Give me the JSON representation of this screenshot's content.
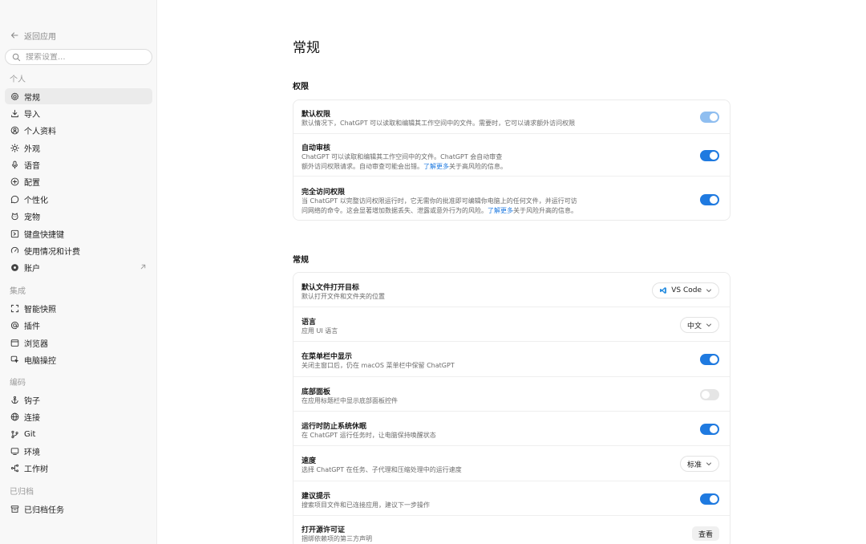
{
  "sidebar": {
    "back_label": "返回应用",
    "search_placeholder": "搜索设置...",
    "groups": [
      {
        "label": "个人",
        "items": [
          {
            "label": "常规",
            "icon": "gear-icon",
            "active": true
          },
          {
            "label": "导入",
            "icon": "download-icon"
          },
          {
            "label": "个人资料",
            "icon": "user-circle-icon"
          },
          {
            "label": "外观",
            "icon": "sun-icon"
          },
          {
            "label": "语音",
            "icon": "microphone-icon"
          },
          {
            "label": "配置",
            "icon": "config-icon"
          },
          {
            "label": "个性化",
            "icon": "chat-bubble-icon"
          },
          {
            "label": "宠物",
            "icon": "pet-icon"
          },
          {
            "label": "键盘快捷键",
            "icon": "keyboard-icon"
          },
          {
            "label": "使用情况和计费",
            "icon": "gauge-icon"
          },
          {
            "label": "账户",
            "icon": "globe-icon",
            "external": true
          }
        ]
      },
      {
        "label": "集成",
        "items": [
          {
            "label": "智能快照",
            "icon": "scan-frame-icon"
          },
          {
            "label": "插件",
            "icon": "at-sign-icon"
          },
          {
            "label": "浏览器",
            "icon": "browser-window-icon"
          },
          {
            "label": "电脑操控",
            "icon": "cursor-click-icon"
          }
        ]
      },
      {
        "label": "编码",
        "items": [
          {
            "label": "钩子",
            "icon": "anchor-icon"
          },
          {
            "label": "连接",
            "icon": "globe-network-icon"
          },
          {
            "label": "Git",
            "icon": "git-branch-icon"
          },
          {
            "label": "环境",
            "icon": "monitor-icon"
          },
          {
            "label": "工作树",
            "icon": "tree-branch-icon"
          }
        ]
      },
      {
        "label": "已归档",
        "items": [
          {
            "label": "已归档任务",
            "icon": "archive-box-icon"
          }
        ]
      }
    ]
  },
  "main": {
    "page_title": "常规",
    "permissions": {
      "title": "权限",
      "rows": [
        {
          "title": "默认权限",
          "desc": "默认情况下，ChatGPT 可以读取和编辑其工作空间中的文件。需要时，它可以请求额外访问权限",
          "toggle": "dim"
        },
        {
          "title": "自动审核",
          "desc1": "ChatGPT 可以读取和编辑其工作空间中的文件。ChatGPT 会自动审查",
          "desc2_pre": "额外访问权限请求。自动审查可能会出错。",
          "link": "了解更多",
          "desc2_post": "关于高风险的信息。",
          "toggle": "on"
        },
        {
          "title": "完全访问权限",
          "desc1": "当 ChatGPT 以完整访问权限运行时，它无需你的批准即可编辑你电脑上的任何文件，并运行可访",
          "desc2_pre": "问网络的命令。这会显著增加数据丢失、泄露或意外行为的风险。",
          "link": "了解更多",
          "desc2_post": "关于风险升高的信息。",
          "toggle": "on"
        }
      ]
    },
    "general": {
      "title": "常规",
      "rows": [
        {
          "title": "默认文件打开目标",
          "desc": "默认打开文件和文件夹的位置",
          "control": "dropdown",
          "value": "VS Code",
          "icon": "vscode-icon"
        },
        {
          "title": "语言",
          "desc": "应用 UI 语言",
          "control": "dropdown",
          "value": "中文"
        },
        {
          "title": "在菜单栏中显示",
          "desc": "关闭主窗口后，仍在 macOS 菜单栏中保留 ChatGPT",
          "control": "toggle",
          "state": "on"
        },
        {
          "title": "底部面板",
          "desc": "在应用标题栏中显示底部面板控件",
          "control": "toggle",
          "state": "off"
        },
        {
          "title": "运行时防止系统休眠",
          "desc": "在 ChatGPT 运行任务时，让电脑保持唤醒状态",
          "control": "toggle",
          "state": "on"
        },
        {
          "title": "速度",
          "desc": "选择 ChatGPT 在任务、子代理和压缩处理中的运行速度",
          "control": "dropdown",
          "value": "标准"
        },
        {
          "title": "建议提示",
          "desc": "搜索项目文件和已连接应用，建议下一步操作",
          "control": "toggle",
          "state": "on"
        },
        {
          "title": "打开源许可证",
          "desc": "捆绑依赖项的第三方声明",
          "control": "button",
          "value": "查看"
        }
      ]
    },
    "colors": {
      "accent": "#1f7ae0",
      "sidebar_bg": "#f8f8f8"
    }
  }
}
